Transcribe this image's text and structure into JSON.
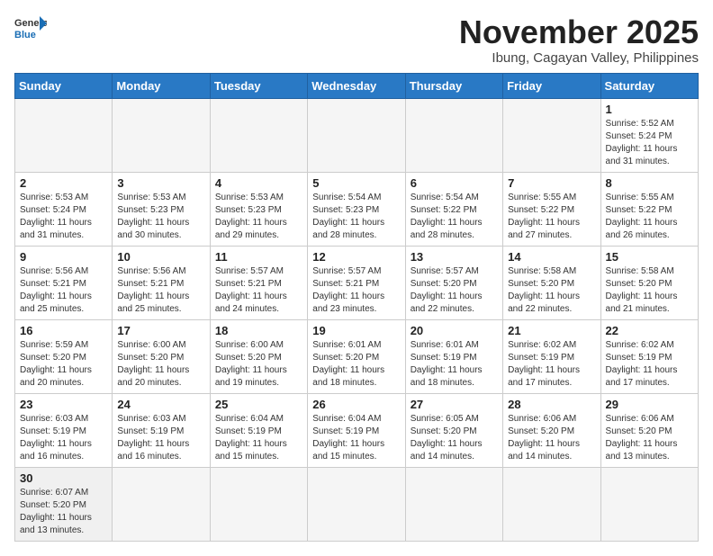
{
  "header": {
    "logo_general": "General",
    "logo_blue": "Blue",
    "month_title": "November 2025",
    "location": "Ibung, Cagayan Valley, Philippines"
  },
  "days_of_week": [
    "Sunday",
    "Monday",
    "Tuesday",
    "Wednesday",
    "Thursday",
    "Friday",
    "Saturday"
  ],
  "weeks": [
    [
      {
        "day": "",
        "info": ""
      },
      {
        "day": "",
        "info": ""
      },
      {
        "day": "",
        "info": ""
      },
      {
        "day": "",
        "info": ""
      },
      {
        "day": "",
        "info": ""
      },
      {
        "day": "",
        "info": ""
      },
      {
        "day": "1",
        "info": "Sunrise: 5:52 AM\nSunset: 5:24 PM\nDaylight: 11 hours\nand 31 minutes."
      }
    ],
    [
      {
        "day": "2",
        "info": "Sunrise: 5:53 AM\nSunset: 5:24 PM\nDaylight: 11 hours\nand 31 minutes."
      },
      {
        "day": "3",
        "info": "Sunrise: 5:53 AM\nSunset: 5:23 PM\nDaylight: 11 hours\nand 30 minutes."
      },
      {
        "day": "4",
        "info": "Sunrise: 5:53 AM\nSunset: 5:23 PM\nDaylight: 11 hours\nand 29 minutes."
      },
      {
        "day": "5",
        "info": "Sunrise: 5:54 AM\nSunset: 5:23 PM\nDaylight: 11 hours\nand 28 minutes."
      },
      {
        "day": "6",
        "info": "Sunrise: 5:54 AM\nSunset: 5:22 PM\nDaylight: 11 hours\nand 28 minutes."
      },
      {
        "day": "7",
        "info": "Sunrise: 5:55 AM\nSunset: 5:22 PM\nDaylight: 11 hours\nand 27 minutes."
      },
      {
        "day": "8",
        "info": "Sunrise: 5:55 AM\nSunset: 5:22 PM\nDaylight: 11 hours\nand 26 minutes."
      }
    ],
    [
      {
        "day": "9",
        "info": "Sunrise: 5:56 AM\nSunset: 5:21 PM\nDaylight: 11 hours\nand 25 minutes."
      },
      {
        "day": "10",
        "info": "Sunrise: 5:56 AM\nSunset: 5:21 PM\nDaylight: 11 hours\nand 25 minutes."
      },
      {
        "day": "11",
        "info": "Sunrise: 5:57 AM\nSunset: 5:21 PM\nDaylight: 11 hours\nand 24 minutes."
      },
      {
        "day": "12",
        "info": "Sunrise: 5:57 AM\nSunset: 5:21 PM\nDaylight: 11 hours\nand 23 minutes."
      },
      {
        "day": "13",
        "info": "Sunrise: 5:57 AM\nSunset: 5:20 PM\nDaylight: 11 hours\nand 22 minutes."
      },
      {
        "day": "14",
        "info": "Sunrise: 5:58 AM\nSunset: 5:20 PM\nDaylight: 11 hours\nand 22 minutes."
      },
      {
        "day": "15",
        "info": "Sunrise: 5:58 AM\nSunset: 5:20 PM\nDaylight: 11 hours\nand 21 minutes."
      }
    ],
    [
      {
        "day": "16",
        "info": "Sunrise: 5:59 AM\nSunset: 5:20 PM\nDaylight: 11 hours\nand 20 minutes."
      },
      {
        "day": "17",
        "info": "Sunrise: 6:00 AM\nSunset: 5:20 PM\nDaylight: 11 hours\nand 20 minutes."
      },
      {
        "day": "18",
        "info": "Sunrise: 6:00 AM\nSunset: 5:20 PM\nDaylight: 11 hours\nand 19 minutes."
      },
      {
        "day": "19",
        "info": "Sunrise: 6:01 AM\nSunset: 5:20 PM\nDaylight: 11 hours\nand 18 minutes."
      },
      {
        "day": "20",
        "info": "Sunrise: 6:01 AM\nSunset: 5:19 PM\nDaylight: 11 hours\nand 18 minutes."
      },
      {
        "day": "21",
        "info": "Sunrise: 6:02 AM\nSunset: 5:19 PM\nDaylight: 11 hours\nand 17 minutes."
      },
      {
        "day": "22",
        "info": "Sunrise: 6:02 AM\nSunset: 5:19 PM\nDaylight: 11 hours\nand 17 minutes."
      }
    ],
    [
      {
        "day": "23",
        "info": "Sunrise: 6:03 AM\nSunset: 5:19 PM\nDaylight: 11 hours\nand 16 minutes."
      },
      {
        "day": "24",
        "info": "Sunrise: 6:03 AM\nSunset: 5:19 PM\nDaylight: 11 hours\nand 16 minutes."
      },
      {
        "day": "25",
        "info": "Sunrise: 6:04 AM\nSunset: 5:19 PM\nDaylight: 11 hours\nand 15 minutes."
      },
      {
        "day": "26",
        "info": "Sunrise: 6:04 AM\nSunset: 5:19 PM\nDaylight: 11 hours\nand 15 minutes."
      },
      {
        "day": "27",
        "info": "Sunrise: 6:05 AM\nSunset: 5:20 PM\nDaylight: 11 hours\nand 14 minutes."
      },
      {
        "day": "28",
        "info": "Sunrise: 6:06 AM\nSunset: 5:20 PM\nDaylight: 11 hours\nand 14 minutes."
      },
      {
        "day": "29",
        "info": "Sunrise: 6:06 AM\nSunset: 5:20 PM\nDaylight: 11 hours\nand 13 minutes."
      }
    ],
    [
      {
        "day": "30",
        "info": "Sunrise: 6:07 AM\nSunset: 5:20 PM\nDaylight: 11 hours\nand 13 minutes."
      },
      {
        "day": "",
        "info": ""
      },
      {
        "day": "",
        "info": ""
      },
      {
        "day": "",
        "info": ""
      },
      {
        "day": "",
        "info": ""
      },
      {
        "day": "",
        "info": ""
      },
      {
        "day": "",
        "info": ""
      }
    ]
  ]
}
